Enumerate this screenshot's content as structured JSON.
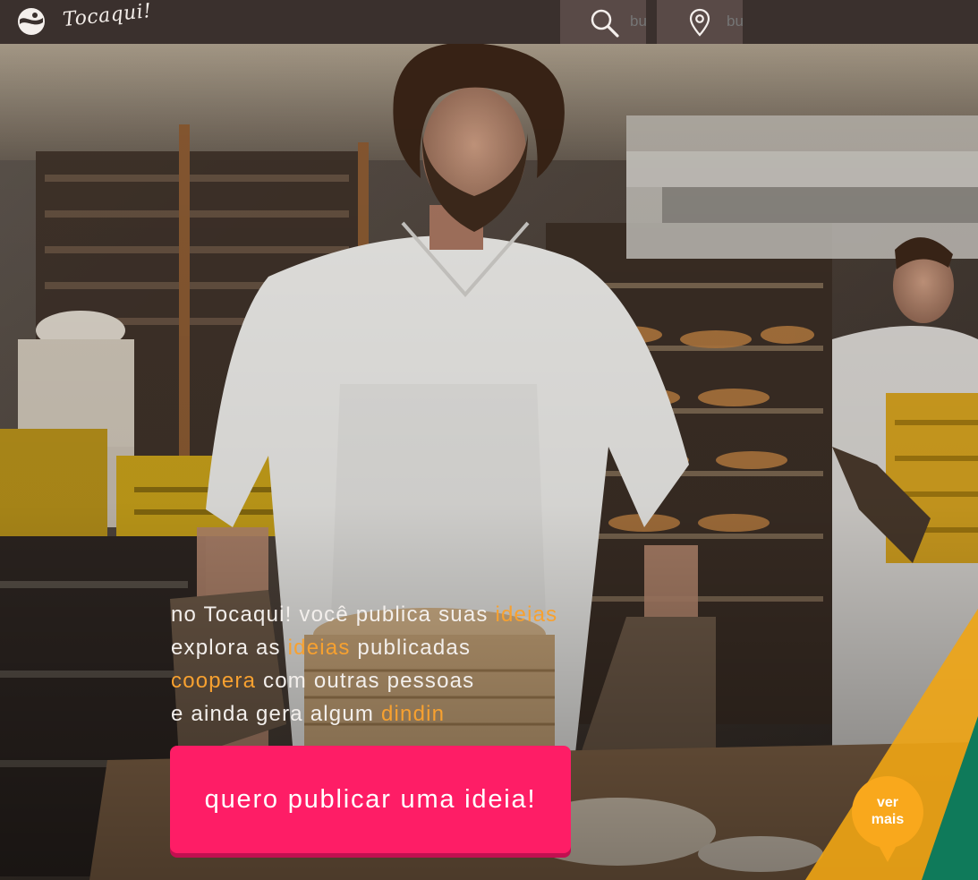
{
  "brand": {
    "name": "Tocaqui!"
  },
  "search": {
    "placeholder": "bu",
    "icon": "search-icon"
  },
  "location": {
    "placeholder": "bu",
    "icon": "location-pin-icon"
  },
  "tagline": {
    "line1": {
      "text": "no Tocaqui! você publica suas ",
      "highlight": "ideias"
    },
    "line2": {
      "text_before": "explora as ",
      "highlight": "ideias",
      "text_after": " publicadas"
    },
    "line3": {
      "highlight": "coopera",
      "text": " com outras pessoas"
    },
    "line4": {
      "text": "e ainda gera algum ",
      "highlight": "dindin"
    }
  },
  "cta": {
    "label": "quero publicar uma ideia!"
  },
  "ver_mais": {
    "label_line1": "ver",
    "label_line2": "mais"
  },
  "colors": {
    "header_bg": "#3a302d",
    "search_bg": "#594a47",
    "highlight": "#f7a130",
    "cta_bg": "#fe1d66",
    "ver_mais_bg": "#f9a81c",
    "corner_yellow": "#f0a514",
    "corner_green": "#0f7a5a"
  }
}
